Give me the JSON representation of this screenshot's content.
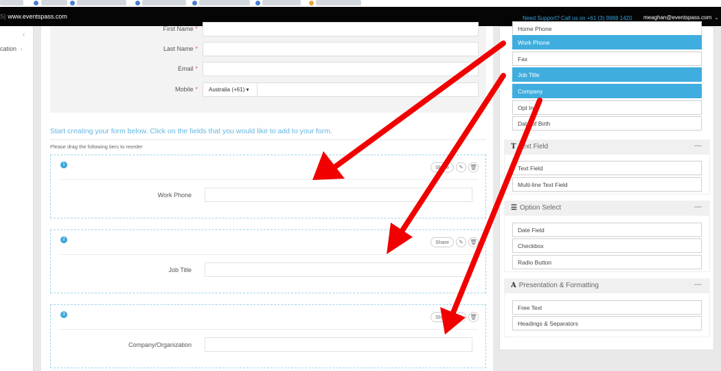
{
  "header": {
    "brand": "www.eventspass.com",
    "support_text": "Need Support? Call us on +61 (3) 9988 1420",
    "user_email": "meaghan@eventspass.com"
  },
  "left_nav": {
    "item_label": "cation"
  },
  "contact_form": {
    "fields": [
      {
        "label": "First Name",
        "required": "*"
      },
      {
        "label": "Last Name",
        "required": "*"
      },
      {
        "label": "Email",
        "required": "*"
      },
      {
        "label": "Mobile",
        "required": "*",
        "country": "Australia (+61)"
      }
    ]
  },
  "builder": {
    "instruction": "Start creating your form below. Click on the fields that you would like to add to your form.",
    "drag_hint": "Please drag the following tiers to reorder",
    "blocks": [
      {
        "number": "1",
        "label": "Work Phone",
        "share_label": "Share"
      },
      {
        "number": "2",
        "label": "Job Title",
        "share_label": "Share"
      },
      {
        "number": "3",
        "label": "Company/Organization",
        "share_label": "Share"
      }
    ]
  },
  "field_panel": {
    "contact_items": [
      {
        "label": "Home Phone",
        "selected": false
      },
      {
        "label": "Work Phone",
        "selected": true
      },
      {
        "label": "Fax",
        "selected": false
      },
      {
        "label": "Job Title",
        "selected": true
      },
      {
        "label": "Company",
        "selected": true
      },
      {
        "label": "Opt In",
        "selected": false
      },
      {
        "label": "Date of Birth",
        "selected": false
      }
    ],
    "sections": [
      {
        "title": "Text Field",
        "icon": "text-icon",
        "items": [
          "Text Field",
          "Multi-line Text Field"
        ]
      },
      {
        "title": "Option Select",
        "icon": "list-icon",
        "items": [
          "Date Field",
          "Checkbox",
          "Radio Button"
        ]
      },
      {
        "title": "Presentation & Formatting",
        "icon": "format-icon",
        "items": [
          "Free Text",
          "Headings & Separators"
        ]
      }
    ]
  },
  "colors": {
    "accent": "#3fadde",
    "annotation_arrow": "#f10000",
    "required": "#e0554d",
    "topbar": "#050505"
  }
}
